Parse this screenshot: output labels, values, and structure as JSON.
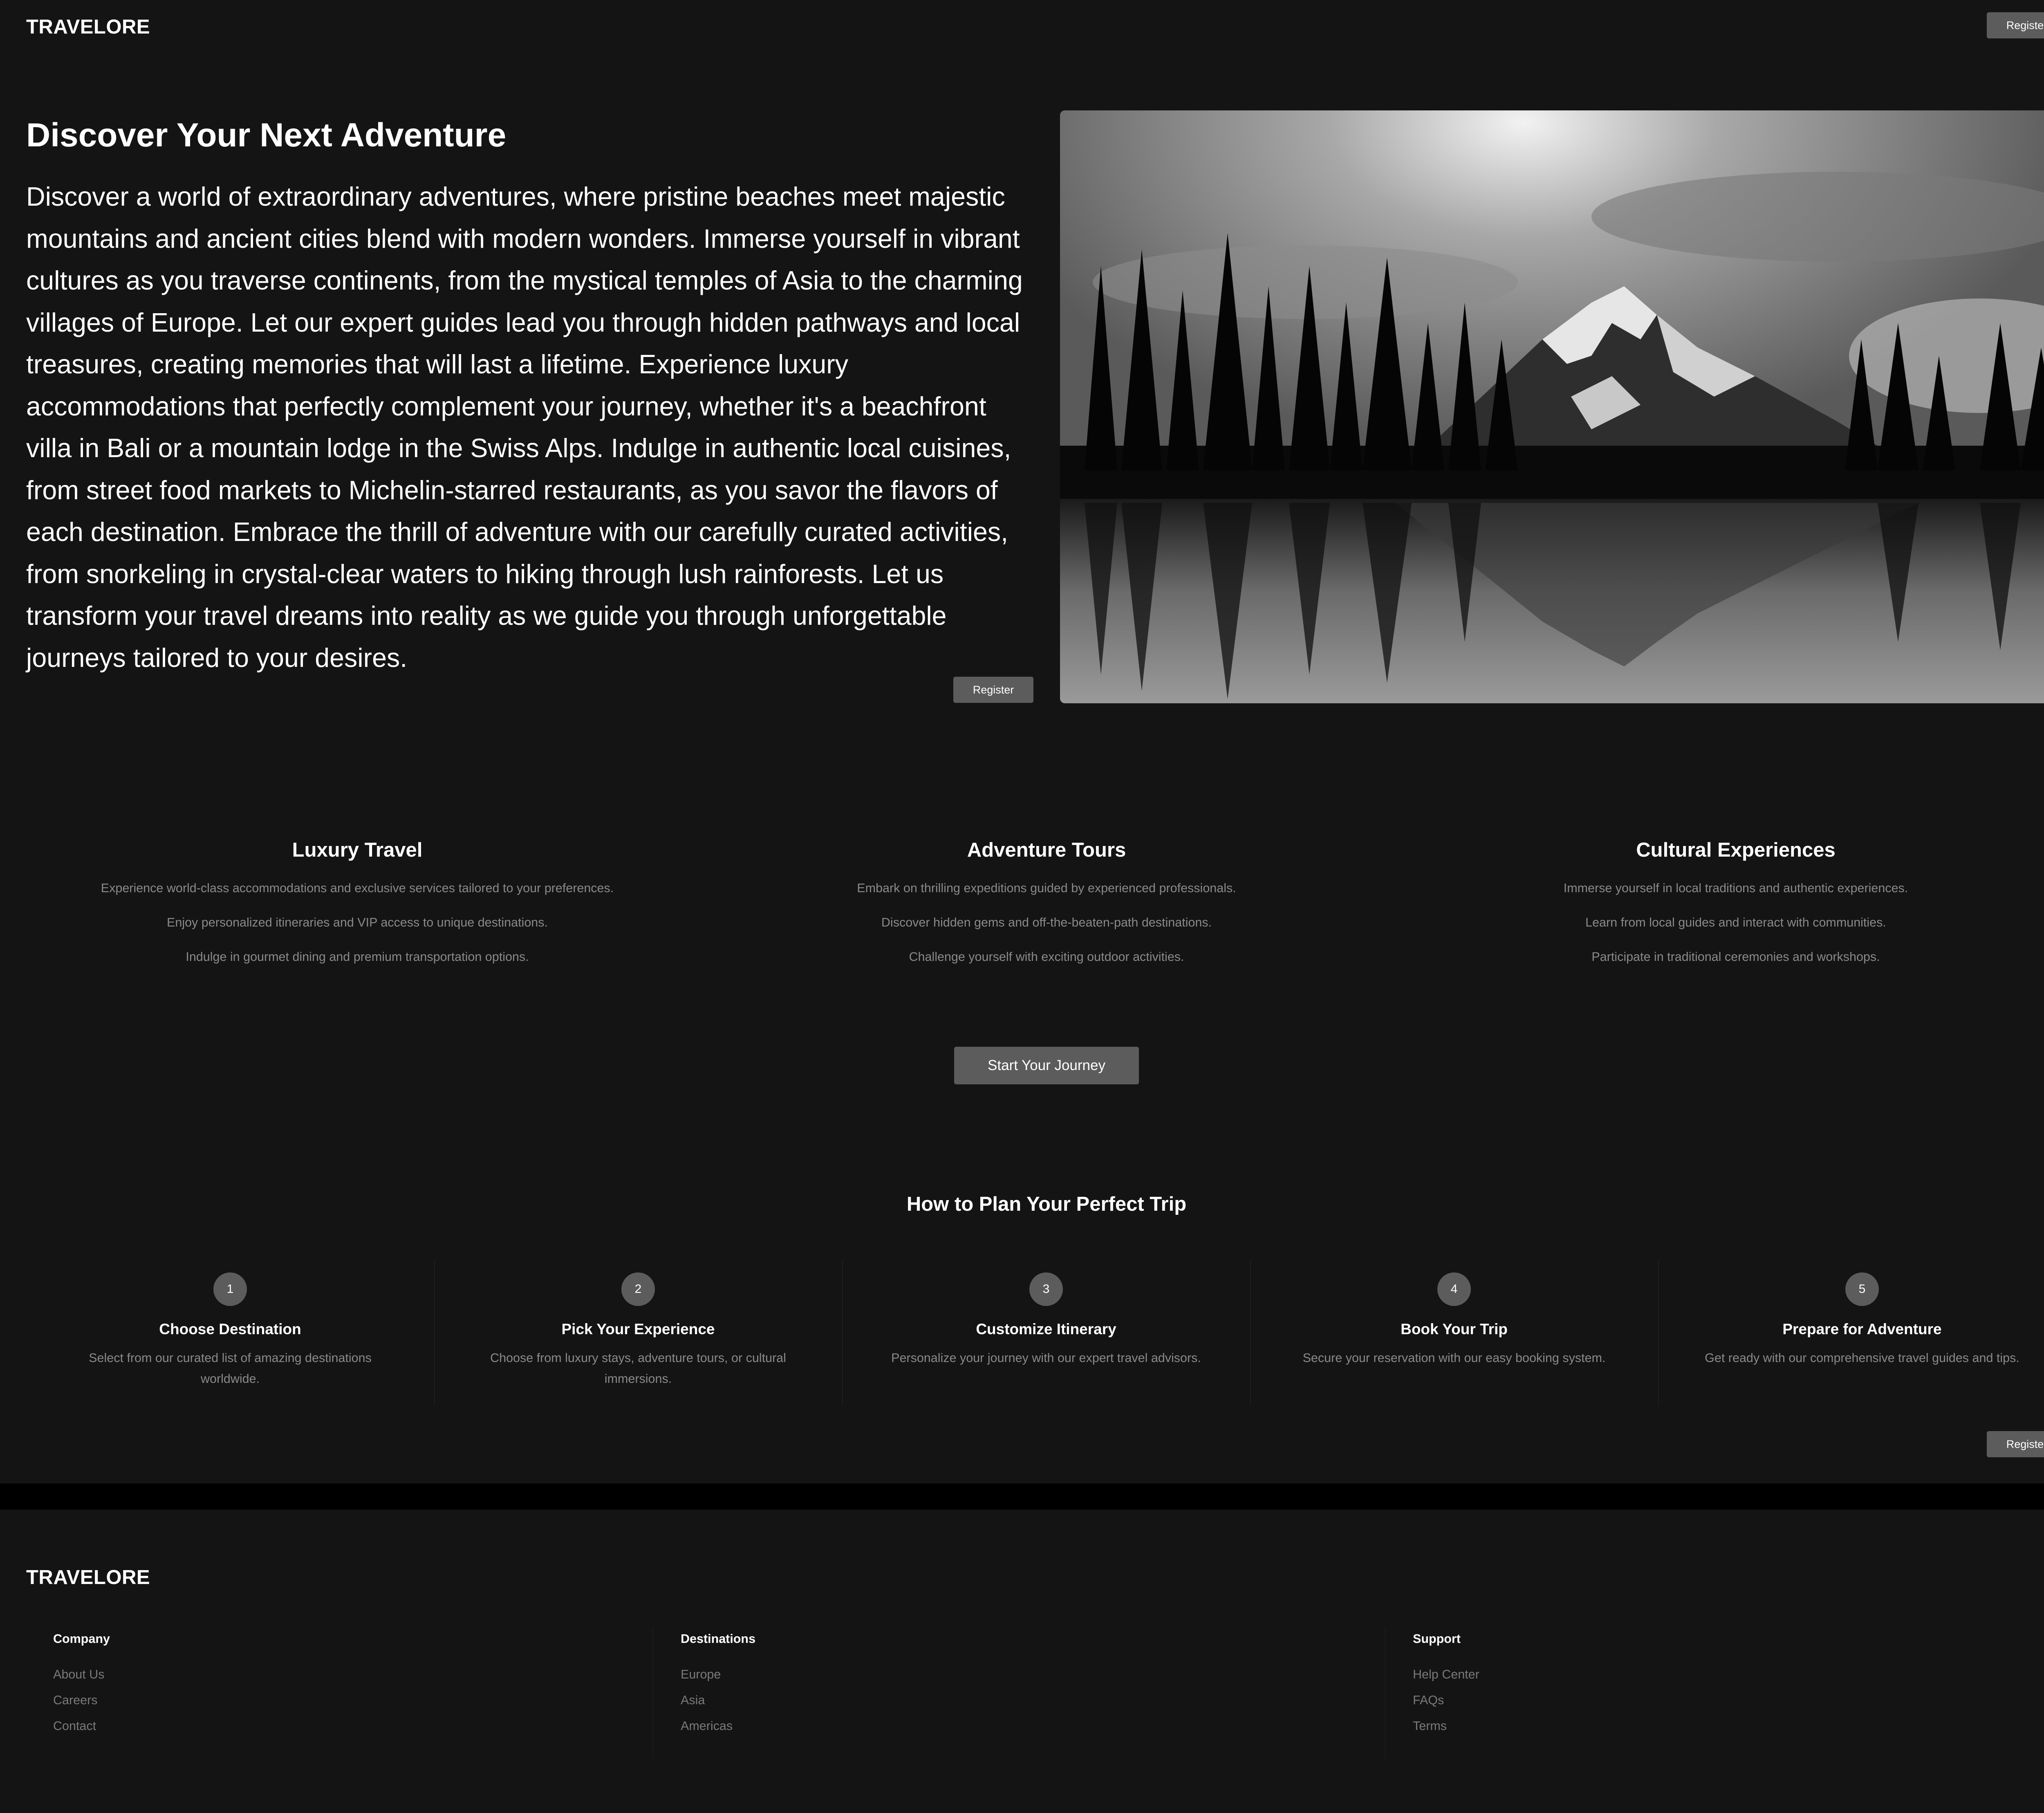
{
  "header": {
    "logo": "TRAVELORE",
    "register_label": "Register"
  },
  "hero": {
    "title": "Discover Your Next Adventure",
    "text": "Discover a world of extraordinary adventures, where pristine beaches meet majestic mountains and ancient cities blend with modern wonders. Immerse yourself in vibrant cultures as you traverse continents, from the mystical temples of Asia to the charming villages of Europe. Let our expert guides lead you through hidden pathways and local treasures, creating memories that will last a lifetime. Experience luxury accommodations that perfectly complement your journey, whether it's a beachfront villa in Bali or a mountain lodge in the Swiss Alps. Indulge in authentic local cuisines, from street food markets to Michelin-starred restaurants, as you savor the flavors of each destination. Embrace the thrill of adventure with our carefully curated activities, from snorkeling in crystal-clear waters to hiking through lush rainforests. Let us transform your travel dreams into reality as we guide you through unforgettable journeys tailored to your desires.",
    "register_label": "Register"
  },
  "features": [
    {
      "title": "Luxury Travel",
      "lines": [
        "Experience world-class accommodations and exclusive services tailored to your preferences.",
        "Enjoy personalized itineraries and VIP access to unique destinations.",
        "Indulge in gourmet dining and premium transportation options."
      ]
    },
    {
      "title": "Adventure Tours",
      "lines": [
        "Embark on thrilling expeditions guided by experienced professionals.",
        "Discover hidden gems and off-the-beaten-path destinations.",
        "Challenge yourself with exciting outdoor activities."
      ]
    },
    {
      "title": "Cultural Experiences",
      "lines": [
        "Immerse yourself in local traditions and authentic experiences.",
        "Learn from local guides and interact with communities.",
        "Participate in traditional ceremonies and workshops."
      ]
    }
  ],
  "cta": {
    "label": "Start Your Journey"
  },
  "steps_section": {
    "title": "How to Plan Your Perfect Trip",
    "steps": [
      {
        "number": "1",
        "title": "Choose Destination",
        "text": "Select from our curated list of amazing destinations worldwide."
      },
      {
        "number": "2",
        "title": "Pick Your Experience",
        "text": "Choose from luxury stays, adventure tours, or cultural immersions."
      },
      {
        "number": "3",
        "title": "Customize Itinerary",
        "text": "Personalize your journey with our expert travel advisors."
      },
      {
        "number": "4",
        "title": "Book Your Trip",
        "text": "Secure your reservation with our easy booking system."
      },
      {
        "number": "5",
        "title": "Prepare for Adventure",
        "text": "Get ready with our comprehensive travel guides and tips."
      }
    ],
    "register_label": "Register"
  },
  "footer": {
    "logo": "TRAVELORE",
    "columns": [
      {
        "heading": "Company",
        "links": [
          "About Us",
          "Careers",
          "Contact"
        ]
      },
      {
        "heading": "Destinations",
        "links": [
          "Europe",
          "Asia",
          "Americas"
        ]
      },
      {
        "heading": "Support",
        "links": [
          "Help Center",
          "FAQs",
          "Terms"
        ]
      }
    ]
  },
  "colors": {
    "background": "#141414",
    "button": "#5c5c5c",
    "muted_text": "#8a8a8a",
    "band": "#000000"
  }
}
